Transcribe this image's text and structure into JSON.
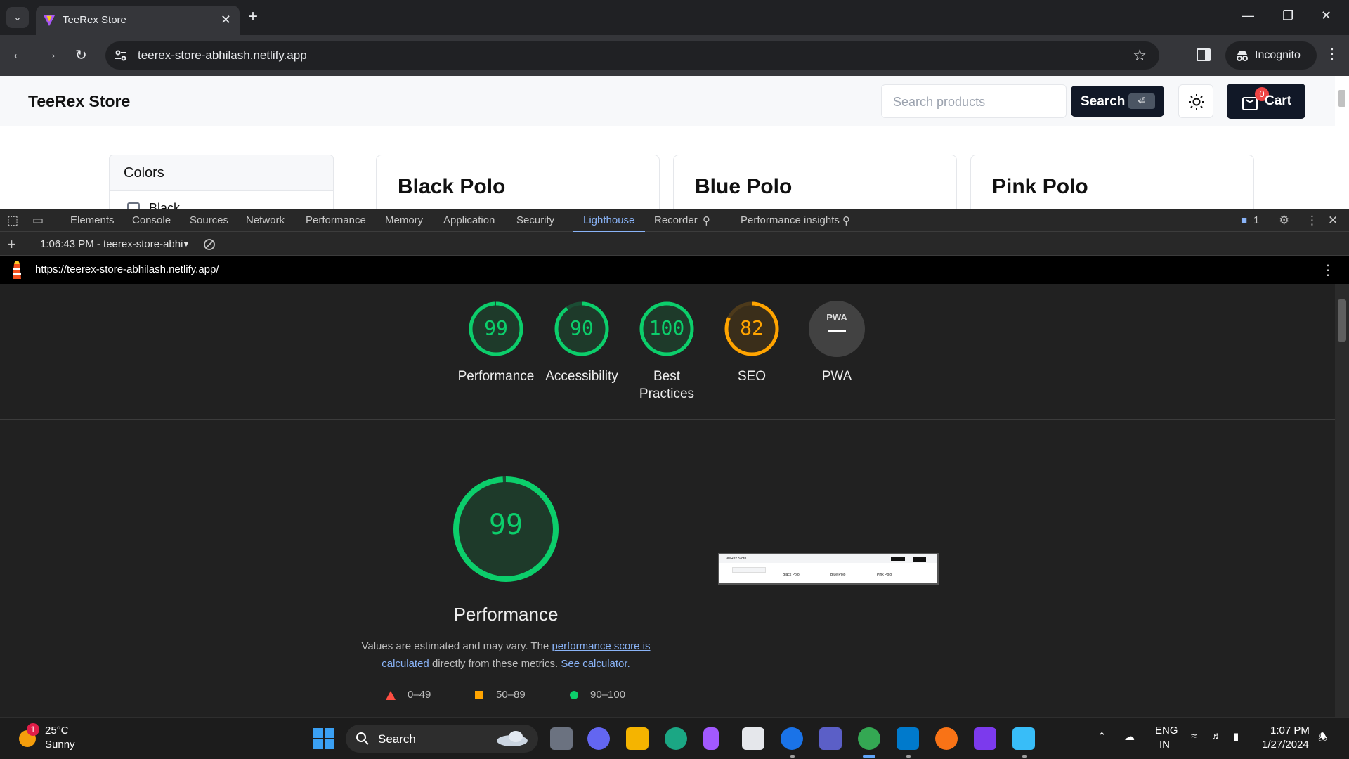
{
  "browser": {
    "tab_title": "TeeRex Store",
    "url": "teerex-store-abhilash.netlify.app",
    "incognito_label": "Incognito"
  },
  "site": {
    "brand": "TeeRex Store",
    "search_placeholder": "Search products",
    "search_button": "Search",
    "cart_label": "Cart",
    "cart_count": "0",
    "filter_title": "Colors",
    "filter_first_option": "Black",
    "products": [
      "Black Polo",
      "Blue Polo",
      "Pink Polo"
    ]
  },
  "devtools": {
    "tabs": [
      "Elements",
      "Console",
      "Sources",
      "Network",
      "Performance",
      "Memory",
      "Application",
      "Security",
      "Lighthouse",
      "Recorder",
      "Performance insights"
    ],
    "active_tab": "Lighthouse",
    "issues_count": "1",
    "report_selector": "1:06:43 PM - teerex-store-abhi",
    "report_url": "https://teerex-store-abhilash.netlify.app/"
  },
  "lighthouse": {
    "scores": [
      {
        "label": "Performance",
        "value": "99",
        "score": 99,
        "color": "#0cce6b"
      },
      {
        "label": "Accessibility",
        "value": "90",
        "score": 90,
        "color": "#0cce6b"
      },
      {
        "label": "Best Practices",
        "value": "100",
        "score": 100,
        "color": "#0cce6b"
      },
      {
        "label": "SEO",
        "value": "82",
        "score": 82,
        "color": "#ffa400"
      },
      {
        "label": "PWA",
        "value": "",
        "score": null,
        "color": "#9e9e9e"
      }
    ],
    "pwa_badge": "PWA",
    "main_score": "99",
    "main_title": "Performance",
    "desc_before": "Values are estimated and may vary. The",
    "desc_link1": "performance score is calculated",
    "desc_middle": "directly from these metrics.",
    "desc_link2": "See calculator.",
    "legend": [
      {
        "range": "0–49",
        "color": "#ff4e42"
      },
      {
        "range": "50–89",
        "color": "#ffa400"
      },
      {
        "range": "90–100",
        "color": "#0cce6b"
      }
    ],
    "thumb_brand": "TeeRex Store",
    "thumb_products": [
      "Black Polo",
      "Blue Polo",
      "Pink Polo"
    ]
  },
  "taskbar": {
    "weather_temp": "25°C",
    "weather_desc": "Sunny",
    "weather_badge": "1",
    "search_label": "Search",
    "lang1": "ENG",
    "lang2": "IN",
    "time": "1:07 PM",
    "date": "1/27/2024"
  }
}
